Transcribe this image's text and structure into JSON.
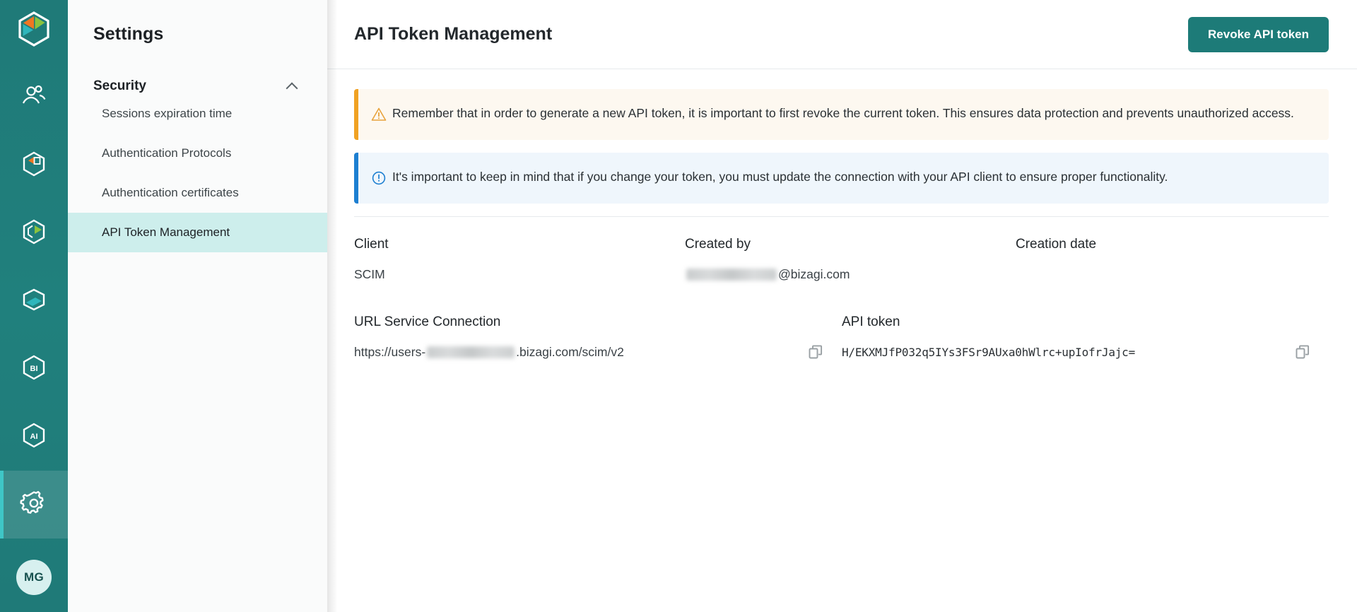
{
  "rail": {
    "logo_icon": "bizagi-hex-logo",
    "items": [
      {
        "icon": "people-icon",
        "name": "people",
        "active": false
      },
      {
        "icon": "hex-automation-icon",
        "name": "automation",
        "active": false
      },
      {
        "icon": "hex-modeler-icon",
        "name": "modeler",
        "active": false
      },
      {
        "icon": "hex-stack-icon",
        "name": "stack",
        "active": false
      },
      {
        "icon": "hex-bi-icon",
        "name": "bi",
        "active": false
      },
      {
        "icon": "hex-ai-icon",
        "name": "ai",
        "active": false
      },
      {
        "icon": "gear-icon",
        "name": "settings",
        "active": true
      }
    ],
    "avatar_initials": "MG"
  },
  "settings": {
    "title": "Settings",
    "section": {
      "label": "Security",
      "chevron": "chevron-up-icon"
    },
    "items": [
      {
        "label": "Sessions expiration time",
        "active": false
      },
      {
        "label": "Authentication Protocols",
        "active": false
      },
      {
        "label": "Authentication certificates",
        "active": false
      },
      {
        "label": "API Token Management",
        "active": true
      }
    ]
  },
  "header": {
    "title": "API Token Management",
    "revoke_label": "Revoke API token"
  },
  "banners": [
    {
      "type": "warning",
      "icon": "warning-triangle-icon",
      "text": "Remember that in order to generate a new API token, it is important to first revoke the current token. This ensures data protection and prevents unauthorized access."
    },
    {
      "type": "info",
      "icon": "info-circle-icon",
      "text": "It's important to keep in mind that if you change your token, you must update the connection with your API client to ensure proper functionality."
    }
  ],
  "details": {
    "client": {
      "label": "Client",
      "value": "SCIM"
    },
    "created_by": {
      "label": "Created by",
      "value_redacted": true,
      "value_suffix": "@bizagi.com"
    },
    "creation_date": {
      "label": "Creation date",
      "value": ""
    },
    "url_service": {
      "label": "URL Service Connection",
      "value_prefix": "https://users-",
      "value_redacted": true,
      "value_suffix": ".bizagi.com/scim/v2",
      "copy_icon": "copy-icon"
    },
    "api_token": {
      "label": "API token",
      "value": "H/EKXMJfP032q5IYs3FSr9AUxa0hWlrc+upIofrJajc=",
      "copy_icon": "copy-icon"
    }
  },
  "colors": {
    "rail_bg": "#1f7a78",
    "accent": "#1d7b78",
    "active_nav_bg": "#cdeeec",
    "warning": "#f0a224",
    "info": "#1d7fd1"
  }
}
